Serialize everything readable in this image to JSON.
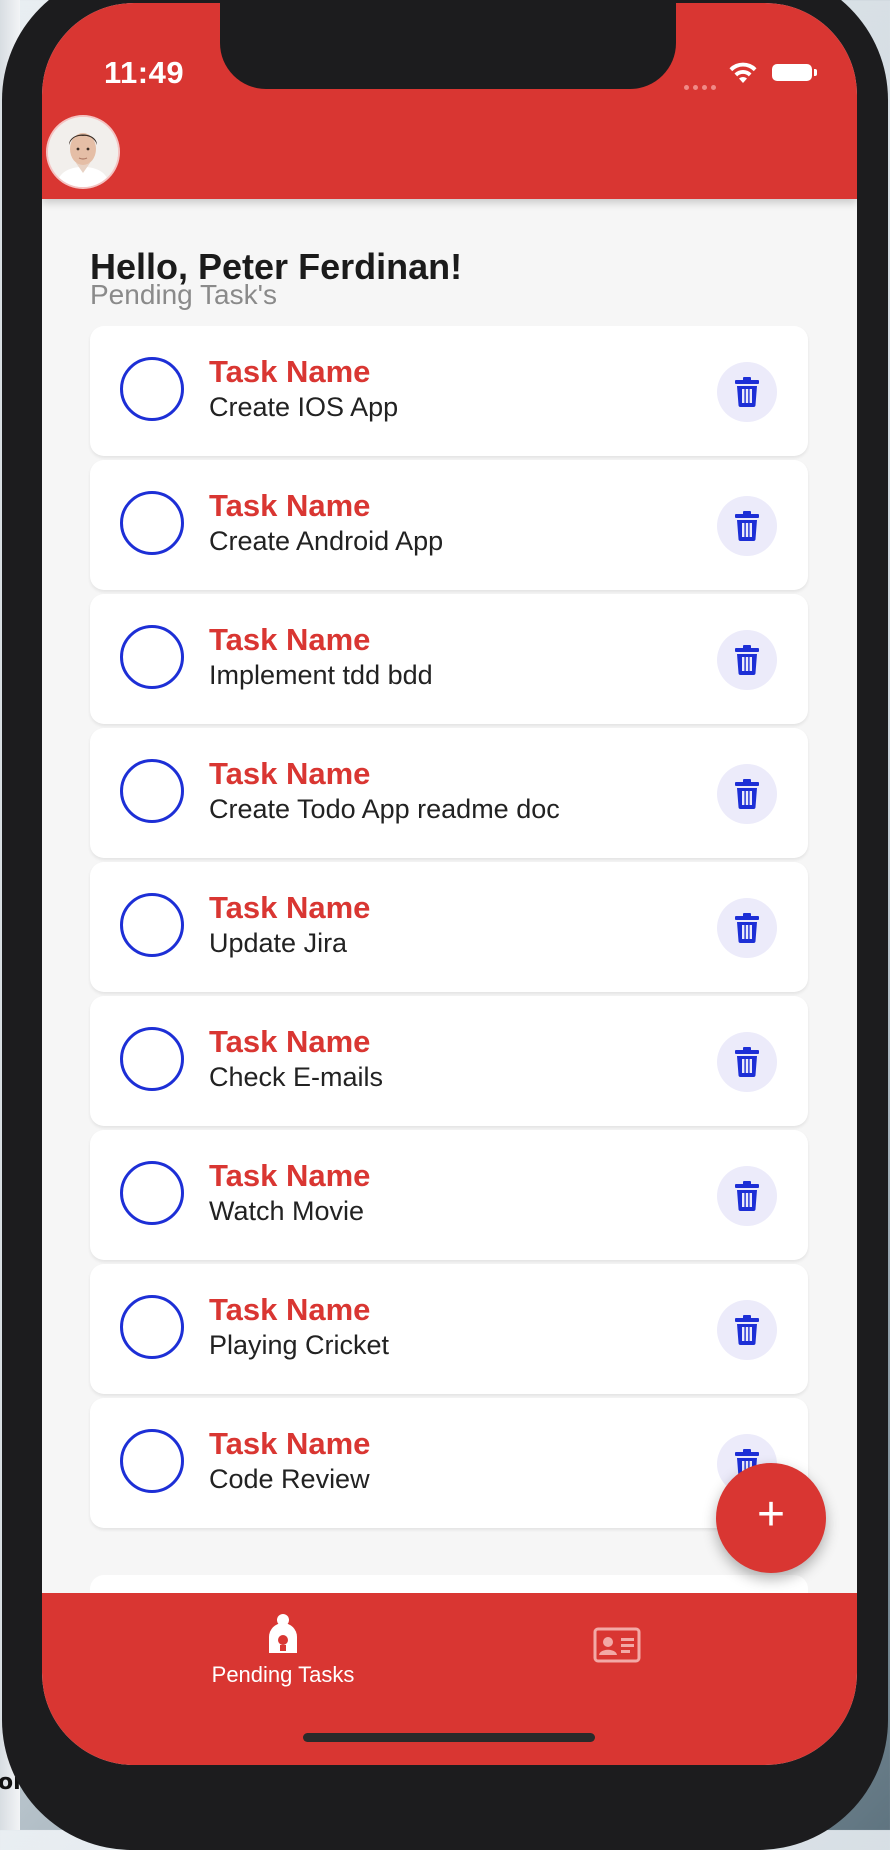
{
  "status_bar": {
    "time": "11:49"
  },
  "header": {
    "avatar": "user-avatar"
  },
  "greeting": {
    "title": "Hello, Peter Ferdinan!",
    "subtitle": "Pending Task's"
  },
  "tasks": [
    {
      "label": "Task Name",
      "name": "Create IOS App"
    },
    {
      "label": "Task Name",
      "name": "Create Android App"
    },
    {
      "label": "Task Name",
      "name": "Implement tdd bdd"
    },
    {
      "label": "Task Name",
      "name": "Create Todo App readme doc"
    },
    {
      "label": "Task Name",
      "name": "Update Jira"
    },
    {
      "label": "Task Name",
      "name": "Check E-mails"
    },
    {
      "label": "Task Name",
      "name": "Watch Movie"
    },
    {
      "label": "Task Name",
      "name": "Playing Cricket"
    },
    {
      "label": "Task Name",
      "name": "Code Review"
    }
  ],
  "fab": {
    "symbol": "+"
  },
  "bottom_nav": {
    "pending_label": "Pending Tasks"
  },
  "background": {
    "fragment_text": "oi"
  },
  "colors": {
    "primary": "#d93632",
    "check_border": "#1d2fd6",
    "delete_bg": "#ecebfa",
    "screen_bg": "#f6f6f6"
  }
}
